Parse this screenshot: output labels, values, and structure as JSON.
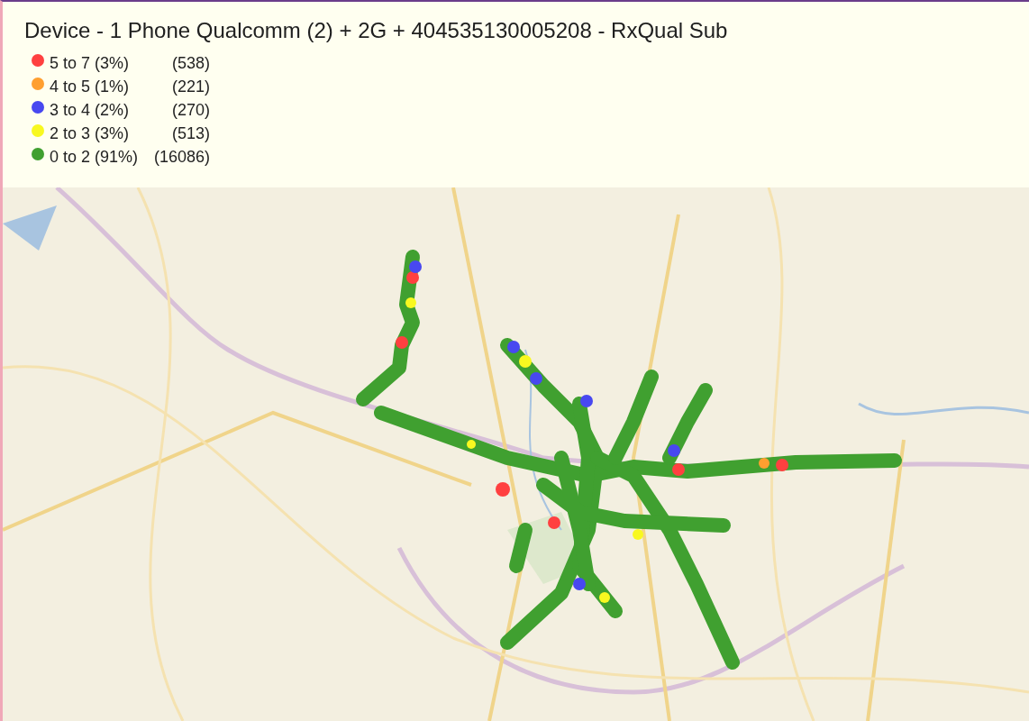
{
  "title": "Device - 1 Phone Qualcomm (2) + 2G + 404535130005208 - RxQual Sub",
  "legend": [
    {
      "label": "5 to 7 (3%)",
      "count": "(538)",
      "color": "#ff4040"
    },
    {
      "label": "4 to 5 (1%)",
      "count": "(221)",
      "color": "#ff9f30"
    },
    {
      "label": "3 to 4 (2%)",
      "count": "(270)",
      "color": "#4848f0"
    },
    {
      "label": "2 to 3 (3%)",
      "count": "(513)",
      "color": "#f8f820"
    },
    {
      "label": "0 to 2 (91%)",
      "count": "(16086)",
      "color": "#40a030"
    }
  ]
}
